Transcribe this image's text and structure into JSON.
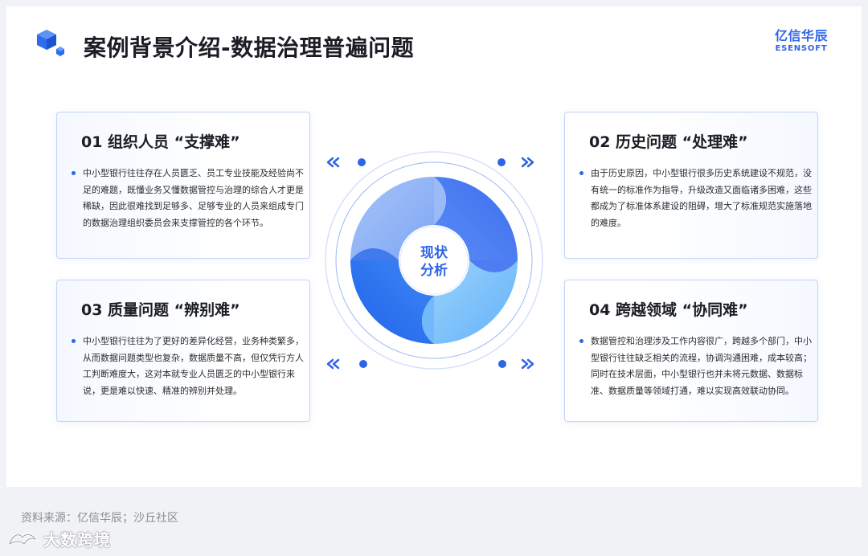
{
  "header": {
    "title": "案例背景介绍-数据治理普遍问题",
    "icon": "blue-cube-icon"
  },
  "brand": {
    "name_cn": "亿信华辰",
    "name_en": "ESENSOFT",
    "color": "#2f64ea"
  },
  "center": {
    "label_line1": "现状",
    "label_line2": "分析"
  },
  "cards": [
    {
      "title": "01 组织人员 “支撑难”",
      "text": "中小型银行往往存在人员匮乏、员工专业技能及经验尚不足的难题，既懂业务又懂数据管控与治理的综合人才更是稀缺，因此很难找到足够多、足够专业的人员来组成专门的数据治理组织委员会来支撑管控的各个环节。"
    },
    {
      "title": "02 历史问题 “处理难”",
      "text": "由于历史原因，中小型银行很多历史系统建设不规范，没有统一的标准作为指导，升级改造又面临诸多困难，这些都成为了标准体系建设的阻碍，增大了标准规范实施落地的难度。"
    },
    {
      "title": "03 质量问题 “辨别难”",
      "text": "中小型银行往往为了更好的差异化经营，业务种类繁多，从而数据问题类型也复杂，数据质量不高，但仅凭行方人工判断难度大，这对本就专业人员匮乏的中小型银行来说，更是难以快速、精准的辨别并处理。"
    },
    {
      "title": "04 跨越领域 “协同难”",
      "text": "数据管控和治理涉及工作内容很广，跨越多个部门，中小型银行往往缺乏相关的流程，协调沟通困难，成本较高；同时在技术层面，中小型银行也并未将元数据、数据标准、数据质量等领域打通，难以实现高效联动协同。"
    }
  ],
  "footer": {
    "source": "资料来源：亿信华辰；沙丘社区"
  },
  "watermark": {
    "text": "大数跨境",
    "icon": "bird-logo-icon"
  },
  "colors": {
    "accent": "#2d65e8",
    "petal_dark": "#2b72f0",
    "petal_mid": "#4a7cf2",
    "petal_light": "#78b8f9",
    "petal_pale": "#8fb3f7"
  }
}
